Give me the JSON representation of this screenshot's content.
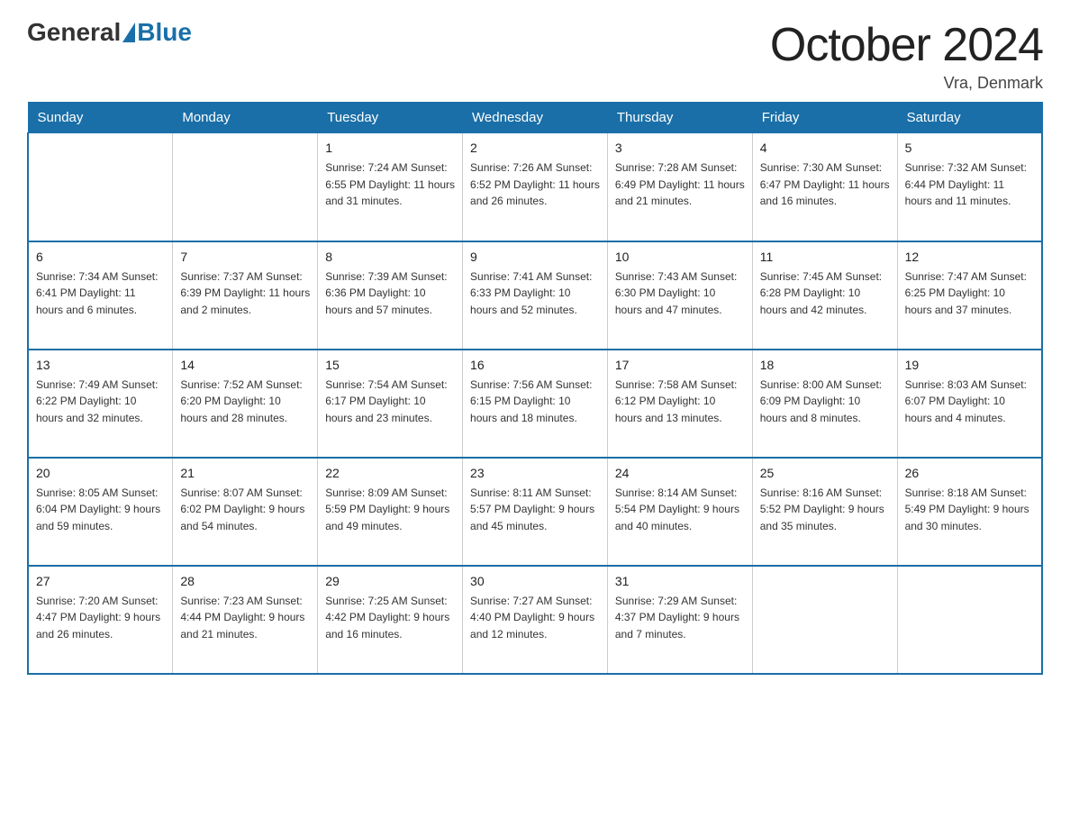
{
  "header": {
    "logo_general": "General",
    "logo_blue": "Blue",
    "month_title": "October 2024",
    "location": "Vra, Denmark"
  },
  "weekdays": [
    "Sunday",
    "Monday",
    "Tuesday",
    "Wednesday",
    "Thursday",
    "Friday",
    "Saturday"
  ],
  "weeks": [
    [
      {
        "day": "",
        "info": ""
      },
      {
        "day": "",
        "info": ""
      },
      {
        "day": "1",
        "info": "Sunrise: 7:24 AM\nSunset: 6:55 PM\nDaylight: 11 hours\nand 31 minutes."
      },
      {
        "day": "2",
        "info": "Sunrise: 7:26 AM\nSunset: 6:52 PM\nDaylight: 11 hours\nand 26 minutes."
      },
      {
        "day": "3",
        "info": "Sunrise: 7:28 AM\nSunset: 6:49 PM\nDaylight: 11 hours\nand 21 minutes."
      },
      {
        "day": "4",
        "info": "Sunrise: 7:30 AM\nSunset: 6:47 PM\nDaylight: 11 hours\nand 16 minutes."
      },
      {
        "day": "5",
        "info": "Sunrise: 7:32 AM\nSunset: 6:44 PM\nDaylight: 11 hours\nand 11 minutes."
      }
    ],
    [
      {
        "day": "6",
        "info": "Sunrise: 7:34 AM\nSunset: 6:41 PM\nDaylight: 11 hours\nand 6 minutes."
      },
      {
        "day": "7",
        "info": "Sunrise: 7:37 AM\nSunset: 6:39 PM\nDaylight: 11 hours\nand 2 minutes."
      },
      {
        "day": "8",
        "info": "Sunrise: 7:39 AM\nSunset: 6:36 PM\nDaylight: 10 hours\nand 57 minutes."
      },
      {
        "day": "9",
        "info": "Sunrise: 7:41 AM\nSunset: 6:33 PM\nDaylight: 10 hours\nand 52 minutes."
      },
      {
        "day": "10",
        "info": "Sunrise: 7:43 AM\nSunset: 6:30 PM\nDaylight: 10 hours\nand 47 minutes."
      },
      {
        "day": "11",
        "info": "Sunrise: 7:45 AM\nSunset: 6:28 PM\nDaylight: 10 hours\nand 42 minutes."
      },
      {
        "day": "12",
        "info": "Sunrise: 7:47 AM\nSunset: 6:25 PM\nDaylight: 10 hours\nand 37 minutes."
      }
    ],
    [
      {
        "day": "13",
        "info": "Sunrise: 7:49 AM\nSunset: 6:22 PM\nDaylight: 10 hours\nand 32 minutes."
      },
      {
        "day": "14",
        "info": "Sunrise: 7:52 AM\nSunset: 6:20 PM\nDaylight: 10 hours\nand 28 minutes."
      },
      {
        "day": "15",
        "info": "Sunrise: 7:54 AM\nSunset: 6:17 PM\nDaylight: 10 hours\nand 23 minutes."
      },
      {
        "day": "16",
        "info": "Sunrise: 7:56 AM\nSunset: 6:15 PM\nDaylight: 10 hours\nand 18 minutes."
      },
      {
        "day": "17",
        "info": "Sunrise: 7:58 AM\nSunset: 6:12 PM\nDaylight: 10 hours\nand 13 minutes."
      },
      {
        "day": "18",
        "info": "Sunrise: 8:00 AM\nSunset: 6:09 PM\nDaylight: 10 hours\nand 8 minutes."
      },
      {
        "day": "19",
        "info": "Sunrise: 8:03 AM\nSunset: 6:07 PM\nDaylight: 10 hours\nand 4 minutes."
      }
    ],
    [
      {
        "day": "20",
        "info": "Sunrise: 8:05 AM\nSunset: 6:04 PM\nDaylight: 9 hours\nand 59 minutes."
      },
      {
        "day": "21",
        "info": "Sunrise: 8:07 AM\nSunset: 6:02 PM\nDaylight: 9 hours\nand 54 minutes."
      },
      {
        "day": "22",
        "info": "Sunrise: 8:09 AM\nSunset: 5:59 PM\nDaylight: 9 hours\nand 49 minutes."
      },
      {
        "day": "23",
        "info": "Sunrise: 8:11 AM\nSunset: 5:57 PM\nDaylight: 9 hours\nand 45 minutes."
      },
      {
        "day": "24",
        "info": "Sunrise: 8:14 AM\nSunset: 5:54 PM\nDaylight: 9 hours\nand 40 minutes."
      },
      {
        "day": "25",
        "info": "Sunrise: 8:16 AM\nSunset: 5:52 PM\nDaylight: 9 hours\nand 35 minutes."
      },
      {
        "day": "26",
        "info": "Sunrise: 8:18 AM\nSunset: 5:49 PM\nDaylight: 9 hours\nand 30 minutes."
      }
    ],
    [
      {
        "day": "27",
        "info": "Sunrise: 7:20 AM\nSunset: 4:47 PM\nDaylight: 9 hours\nand 26 minutes."
      },
      {
        "day": "28",
        "info": "Sunrise: 7:23 AM\nSunset: 4:44 PM\nDaylight: 9 hours\nand 21 minutes."
      },
      {
        "day": "29",
        "info": "Sunrise: 7:25 AM\nSunset: 4:42 PM\nDaylight: 9 hours\nand 16 minutes."
      },
      {
        "day": "30",
        "info": "Sunrise: 7:27 AM\nSunset: 4:40 PM\nDaylight: 9 hours\nand 12 minutes."
      },
      {
        "day": "31",
        "info": "Sunrise: 7:29 AM\nSunset: 4:37 PM\nDaylight: 9 hours\nand 7 minutes."
      },
      {
        "day": "",
        "info": ""
      },
      {
        "day": "",
        "info": ""
      }
    ]
  ]
}
